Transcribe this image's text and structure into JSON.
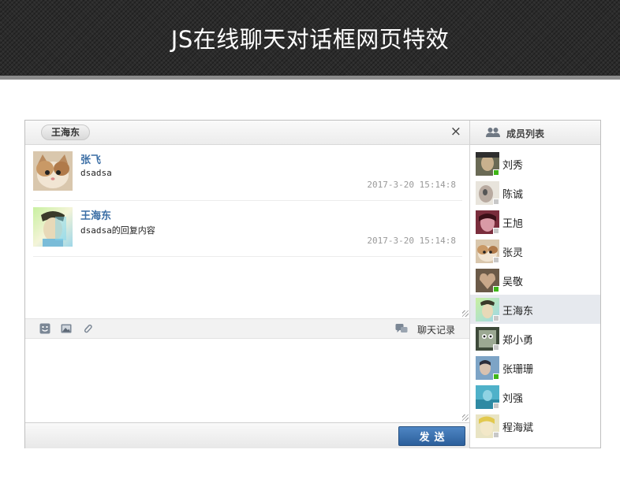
{
  "page": {
    "title": "JS在线聊天对话框网页特效"
  },
  "chat": {
    "current_contact": "王海东",
    "close_icon": "×",
    "messages": [
      {
        "name": "张飞",
        "text": "dsadsa",
        "time": "2017-3-20 15:14:8",
        "avatar": "cat-avatar"
      },
      {
        "name": "王海东",
        "text": "dsadsa的回复内容",
        "time": "2017-3-20 15:14:8",
        "avatar": "man-avatar"
      }
    ],
    "toolbar": {
      "icons": [
        "smiley-icon",
        "image-icon",
        "paperclip-icon"
      ],
      "history_icon": "chat-history-icon",
      "history_label": "聊天记录"
    },
    "input": {
      "value": "",
      "placeholder": ""
    },
    "send_label": "发送",
    "colors": {
      "accent": "#3b6ea5",
      "send_button": "#3b74b3",
      "online": "#3fb618",
      "offline": "#c8c8c8"
    }
  },
  "members": {
    "header_icon": "users-icon",
    "header_label": "成员列表",
    "items": [
      {
        "name": "刘秀",
        "status": "online"
      },
      {
        "name": "陈诚",
        "status": "offline"
      },
      {
        "name": "王旭",
        "status": "offline"
      },
      {
        "name": "张灵",
        "status": "offline"
      },
      {
        "name": "吴敬",
        "status": "online"
      },
      {
        "name": "王海东",
        "status": "offline",
        "selected": true
      },
      {
        "name": "郑小勇",
        "status": "offline"
      },
      {
        "name": "张珊珊",
        "status": "online"
      },
      {
        "name": "刘强",
        "status": "offline"
      },
      {
        "name": "程海斌",
        "status": "offline"
      }
    ]
  }
}
